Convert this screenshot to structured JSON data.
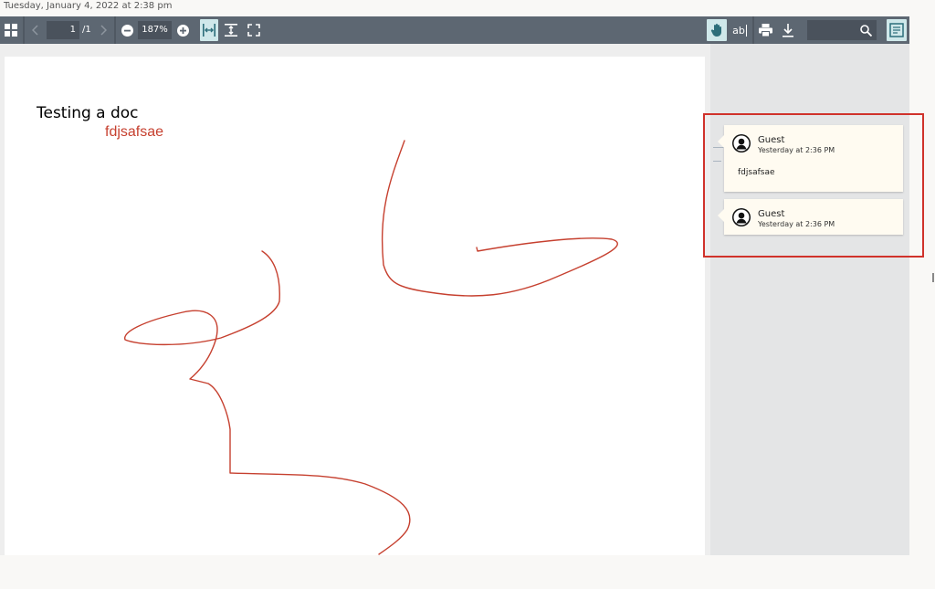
{
  "timestamp": "Tuesday, January 4, 2022 at 2:38 pm",
  "toolbar": {
    "page_current": "1",
    "page_total": "/1",
    "zoom": "187%",
    "icons": [
      "grid-icon",
      "prev-page-icon",
      "next-page-icon",
      "zoom-out-icon",
      "zoom-in-icon",
      "fit-width-icon",
      "fit-page-icon",
      "fullscreen-icon",
      "pan-hand-icon",
      "text-select-icon",
      "print-icon",
      "download-icon",
      "search-icon",
      "notes-panel-icon"
    ],
    "text_tool_label": "ab",
    "accent": "#cfe8ea",
    "bar_color": "#5d6772"
  },
  "document": {
    "title": "Testing a doc",
    "note": "fdjsafsae",
    "ink_color": "#c6402f"
  },
  "comments": [
    {
      "author": "Guest",
      "time": "Yesterday at 2:36 PM",
      "body": "fdjsafsae"
    },
    {
      "author": "Guest",
      "time": "Yesterday at 2:36 PM",
      "body": ""
    }
  ],
  "highlight_color": "#d0322b"
}
